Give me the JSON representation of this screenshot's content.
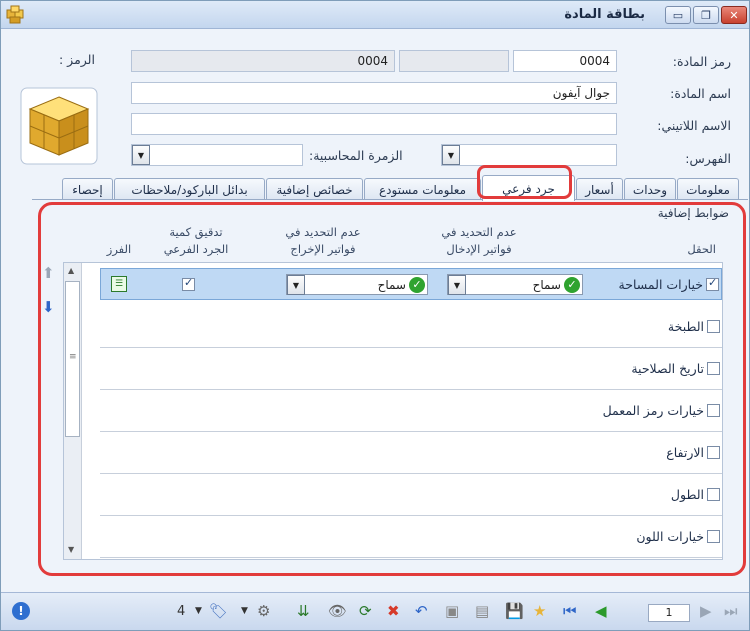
{
  "window": {
    "title": "بطاقة المادة",
    "minimize_glyph": "▭",
    "restore_glyph": "❐",
    "close_glyph": "✕"
  },
  "form": {
    "code_label": "رمز المادة:",
    "code_value": "0004",
    "code2_label": "الرمز :",
    "code2_value": "0004",
    "name_label": "اسم المادة:",
    "name_value": "جوال آيفون",
    "latin_label": "الاسم اللاتيني:",
    "latin_value": "",
    "index_label": "الفهرس:",
    "index_value": "",
    "account_group_label": "الزمرة المحاسبية:",
    "account_group_value": ""
  },
  "tabs": [
    {
      "label": "معلومات"
    },
    {
      "label": "وحدات"
    },
    {
      "label": "أسعار"
    },
    {
      "label": "جرد فرعي"
    },
    {
      "label": "معلومات مستودع"
    },
    {
      "label": "خصائص إضافية"
    },
    {
      "label": "بدائل الباركود/ملاحظات"
    },
    {
      "label": "إحصاء"
    }
  ],
  "panel": {
    "section_title": "ضوابط إضافية",
    "columns": {
      "field": "الحقل",
      "no_spec_input": "عدم التحديد في\nفواتير الإدخال",
      "no_spec_output": "عدم التحديد في\nفواتير الإخراج",
      "check_qty": "تدقيق كمية\nالجرد الفرعي",
      "sort": "الفرز"
    },
    "rows": [
      {
        "label": "خيارات المساحة",
        "checked": true,
        "input": "سماح",
        "output": "سماح",
        "check_qty": true
      },
      {
        "label": "الطبخة",
        "checked": false
      },
      {
        "label": "تاريخ الصلاحية",
        "checked": false
      },
      {
        "label": "خيارات رمز المعمل",
        "checked": false
      },
      {
        "label": "الارتفاع",
        "checked": false
      },
      {
        "label": "الطول",
        "checked": false
      },
      {
        "label": "خيارات اللون",
        "checked": false
      }
    ]
  },
  "toolbar": {
    "count_value": "4",
    "page_value": "1"
  },
  "colors": {
    "highlight": "#e23b3b",
    "selected_row": "#bfd9f4"
  }
}
